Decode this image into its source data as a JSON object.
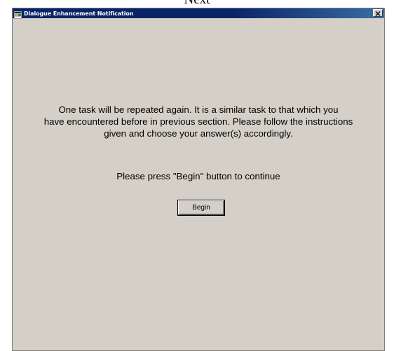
{
  "page": {
    "top_caption": "Next"
  },
  "window": {
    "title": "Dialogue Enhancement Notification",
    "app_icon": "application-icon",
    "close_label": "×"
  },
  "message": {
    "lines": [
      "One task will be repeated again.  It is a similar task to that which you",
      "have encountered before in previous section. Please follow the instructions",
      "given and choose your answer(s) accordingly."
    ],
    "instruction": "Please press \"Begin\" button to continue"
  },
  "actions": {
    "begin_label": "Begin"
  }
}
